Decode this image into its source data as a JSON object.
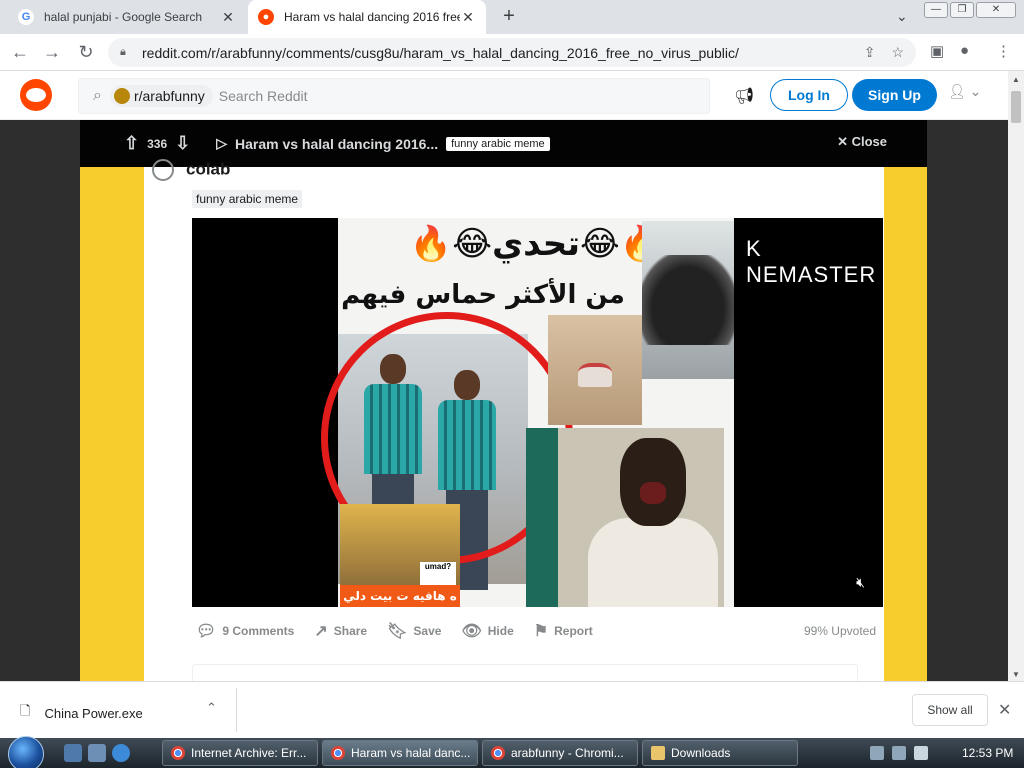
{
  "browser": {
    "tabs": [
      {
        "title": "halal punjabi - Google Search",
        "favicon": "G"
      },
      {
        "title": "Haram vs halal dancing 2016 free",
        "favicon": "reddit"
      }
    ],
    "url": "reddit.com/r/arabfunny/comments/cusg8u/haram_vs_halal_dancing_2016_free_no_virus_public/"
  },
  "reddit": {
    "subreddit_chip": "r/arabfunny",
    "search_placeholder": "Search Reddit",
    "login_label": "Log In",
    "signup_label": "Sign Up"
  },
  "post": {
    "score": "336",
    "title": "Haram vs halal dancing 2016...",
    "flair": "funny arabic meme",
    "close_label": "Close",
    "author_line": "colab",
    "video_overlay_title": "تحدي",
    "video_overlay_subtitle": "من الأكثر حماس فيهم",
    "video_watermark": "NEMASTER",
    "video_bottom_caption": "ه هافيه ت بيت دلي",
    "video_sticker": "umad?",
    "actions": {
      "comments": "9 Comments",
      "share": "Share",
      "save": "Save",
      "hide": "Hide",
      "report": "Report",
      "upvoted": "99% Upvoted"
    }
  },
  "downloads": {
    "file": "China Power.exe",
    "show_all": "Show all"
  },
  "taskbar": {
    "buttons": [
      "Internet Archive: Err...",
      "Haram vs halal danc...",
      "arabfunny - Chromi...",
      "Downloads"
    ],
    "clock": "12:53 PM"
  },
  "colors": {
    "reddit_orange": "#ff4500",
    "reddit_blue": "#0079d3",
    "side_yellow": "#f7cd2e"
  }
}
